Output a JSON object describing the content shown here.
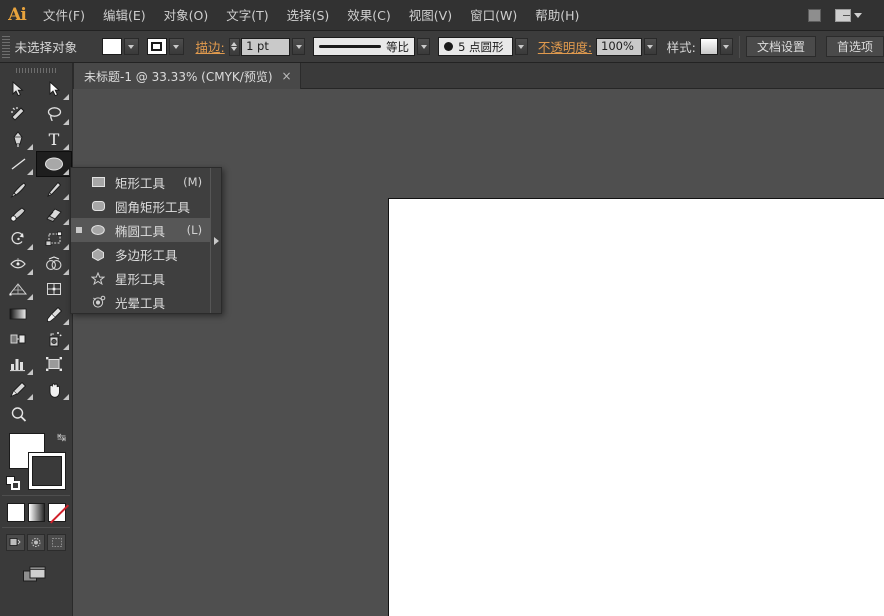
{
  "app": {
    "logo_text": "Ai",
    "brand_color": "#e8a33d",
    "bg_color": "#535353"
  },
  "menubar": {
    "items": [
      {
        "label": "文件(F)",
        "name": "menu-file"
      },
      {
        "label": "编辑(E)",
        "name": "menu-edit"
      },
      {
        "label": "对象(O)",
        "name": "menu-object"
      },
      {
        "label": "文字(T)",
        "name": "menu-type"
      },
      {
        "label": "选择(S)",
        "name": "menu-select"
      },
      {
        "label": "效果(C)",
        "name": "menu-effect"
      },
      {
        "label": "视图(V)",
        "name": "menu-view"
      },
      {
        "label": "窗口(W)",
        "name": "menu-window"
      },
      {
        "label": "帮助(H)",
        "name": "menu-help"
      }
    ],
    "bridge_icon": "bridge-icon",
    "arrange_icon": "arrange-documents-icon"
  },
  "controlbar": {
    "selection_status": "未选择对象",
    "fill_label": "fill-swatch",
    "stroke_color_label": "stroke-swatch",
    "stroke_label": "描边:",
    "stroke_weight": "1 pt",
    "profile_label": "等比",
    "brush_label": "5 点圆形",
    "opacity_label": "不透明度:",
    "opacity_value": "100%",
    "style_label": "样式:",
    "doc_setup_button": "文档设置",
    "preferences_button": "首选项"
  },
  "tabbar": {
    "collapse_icon": "collapse-panel-icon",
    "document_tab": "未标题-1 @ 33.33% (CMYK/预览)",
    "close_icon": "×"
  },
  "toolbar": {
    "gripper": "toolbar-drag-handle",
    "tools": [
      {
        "name": "selection-tool",
        "icon": "arrow-black",
        "has_flyout": false
      },
      {
        "name": "direct-selection-tool",
        "icon": "arrow-white",
        "has_flyout": true
      },
      {
        "name": "magic-wand-tool",
        "icon": "magic-wand",
        "has_flyout": false
      },
      {
        "name": "lasso-tool",
        "icon": "lasso",
        "has_flyout": false
      },
      {
        "name": "pen-tool",
        "icon": "pen",
        "has_flyout": true
      },
      {
        "name": "type-tool",
        "icon": "type-T",
        "has_flyout": true
      },
      {
        "name": "line-segment-tool",
        "icon": "line",
        "has_flyout": true
      },
      {
        "name": "ellipse-tool",
        "icon": "ellipse",
        "has_flyout": true,
        "selected": true
      },
      {
        "name": "paintbrush-tool",
        "icon": "paintbrush",
        "has_flyout": false
      },
      {
        "name": "pencil-tool",
        "icon": "pencil",
        "has_flyout": true
      },
      {
        "name": "blob-brush-tool",
        "icon": "blob-brush",
        "has_flyout": false
      },
      {
        "name": "eraser-tool",
        "icon": "eraser",
        "has_flyout": true
      },
      {
        "name": "rotate-tool",
        "icon": "rotate",
        "has_flyout": true
      },
      {
        "name": "scale-tool",
        "icon": "scale",
        "has_flyout": true
      },
      {
        "name": "width-tool",
        "icon": "width",
        "has_flyout": true
      },
      {
        "name": "shape-builder-tool",
        "icon": "shape-builder",
        "has_flyout": true
      },
      {
        "name": "perspective-grid-tool",
        "icon": "perspective-grid",
        "has_flyout": true
      },
      {
        "name": "mesh-tool",
        "icon": "mesh",
        "has_flyout": false
      },
      {
        "name": "gradient-tool",
        "icon": "gradient",
        "has_flyout": false
      },
      {
        "name": "eyedropper-tool",
        "icon": "eyedropper",
        "has_flyout": true
      },
      {
        "name": "blend-tool",
        "icon": "blend",
        "has_flyout": false
      },
      {
        "name": "symbol-sprayer-tool",
        "icon": "symbol-sprayer",
        "has_flyout": true
      },
      {
        "name": "column-graph-tool",
        "icon": "bar-graph",
        "has_flyout": true
      },
      {
        "name": "artboard-tool",
        "icon": "artboard",
        "has_flyout": false
      },
      {
        "name": "slice-tool",
        "icon": "slice",
        "has_flyout": true
      },
      {
        "name": "hand-tool",
        "icon": "hand",
        "has_flyout": true
      },
      {
        "name": "zoom-tool",
        "icon": "magnifier",
        "has_flyout": false
      }
    ],
    "fill_stroke": {
      "fill_name": "fill-color-swatch",
      "fill_color": "#ffffff",
      "stroke_name": "stroke-color-swatch",
      "stroke_color": "#ffffff",
      "swap_icon": "swap-fill-stroke-icon",
      "default_icon": "default-fill-stroke-icon"
    },
    "color_modes": [
      {
        "name": "color-mode-button",
        "icon": "solid-color"
      },
      {
        "name": "gradient-mode-button",
        "icon": "gradient"
      },
      {
        "name": "none-mode-button",
        "icon": "none-slash"
      }
    ],
    "draw_modes": [
      {
        "name": "draw-normal-button",
        "icon": "draw-normal"
      },
      {
        "name": "draw-behind-button",
        "icon": "draw-behind"
      },
      {
        "name": "draw-inside-button",
        "icon": "draw-inside"
      }
    ],
    "screen_mode": {
      "name": "change-screen-mode-button",
      "icon": "screen-mode"
    }
  },
  "flyout": {
    "name": "shape-tools-flyout",
    "items": [
      {
        "label": "矩形工具",
        "shortcut": "(M)",
        "icon": "rectangle-icon",
        "active": false
      },
      {
        "label": "圆角矩形工具",
        "shortcut": "",
        "icon": "rounded-rect-icon",
        "active": false
      },
      {
        "label": "椭圆工具",
        "shortcut": "(L)",
        "icon": "ellipse-icon",
        "active": true
      },
      {
        "label": "多边形工具",
        "shortcut": "",
        "icon": "polygon-icon",
        "active": false
      },
      {
        "label": "星形工具",
        "shortcut": "",
        "icon": "star-icon",
        "active": false
      },
      {
        "label": "光晕工具",
        "shortcut": "",
        "icon": "flare-icon",
        "active": false
      }
    ],
    "tearoff_icon": "tearoff-arrow-icon"
  },
  "workspace": {
    "name": "canvas-workspace",
    "artboard_name": "artboard",
    "artboard_color": "#ffffff"
  }
}
